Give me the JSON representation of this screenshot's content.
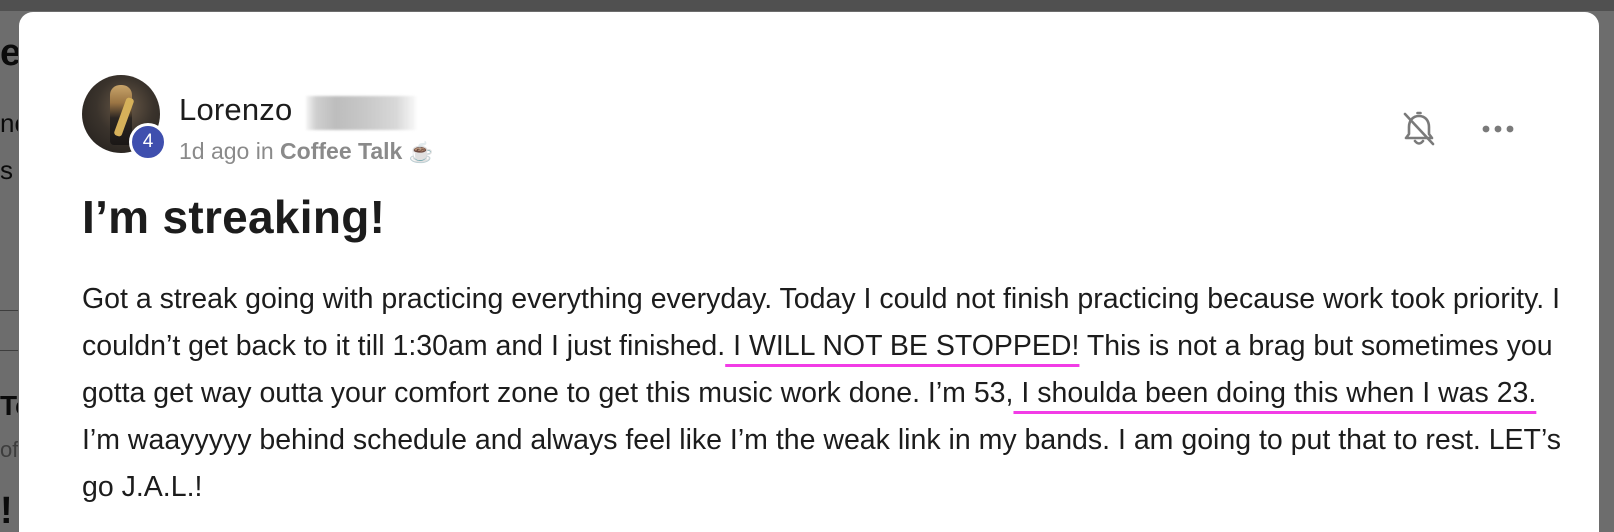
{
  "post": {
    "author": {
      "name": "Lorenzo",
      "level": "4"
    },
    "meta": {
      "time": "1d ago",
      "in_label": "in",
      "channel": "Coffee Talk",
      "channel_emoji": "☕"
    },
    "title": "I’m streaking!",
    "body": {
      "segment_1": "Got a streak going with practicing everything everyday. Today I could not finish practicing because work took priority. I couldn’t get back to it till 1:30am and I just finished.",
      "highlight_1": " I WILL NOT BE STOPPED!",
      "segment_2": " This is not a brag but sometimes you gotta get way outta your comfort zone to get this music work done. I’m 53,",
      "highlight_2": " I shoulda been doing this when I was 23. ",
      "segment_3": "I’m waayyyyy behind schedule and always feel like I’m the weak link in my bands. I am going to put that to rest. LET’s go J.A.L.!"
    },
    "highlight_color": "#f23ce6"
  },
  "icons": {
    "bell": "bell-off-icon",
    "more": "more-horizontal-icon"
  },
  "colors": {
    "level_badge": "#3f4fae",
    "text": "#1c1c1c",
    "meta_text": "#8a8a8a",
    "card": "#ffffff"
  },
  "background": {
    "fragments": [
      "e",
      "nc",
      "s",
      "To",
      "of",
      "!"
    ]
  }
}
